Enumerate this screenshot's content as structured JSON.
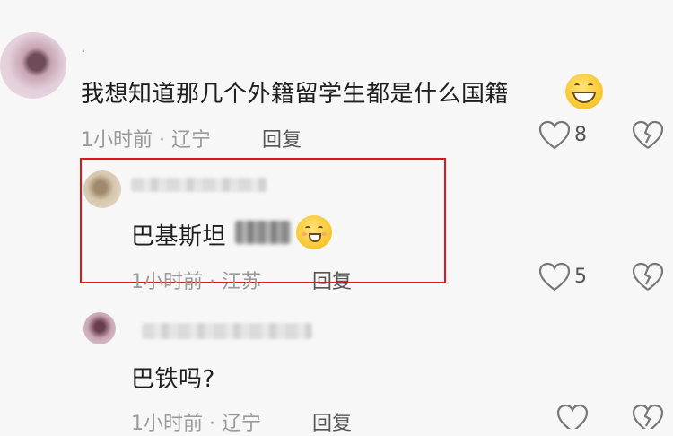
{
  "comments": [
    {
      "author": ".",
      "text": "我想知道那几个外籍留学生都是什么国籍",
      "emoji": "grinning-face-emoji",
      "time_location": "1小时前 · 辽宁",
      "reply_label": "回复",
      "likes": "8",
      "icons": [
        "heart-icon",
        "broken-heart-icon"
      ]
    },
    {
      "text": "巴基斯坦",
      "emoji": "hugging-face-emoji",
      "time_location": "1小时前 · 江苏",
      "reply_label": "回复",
      "likes": "5",
      "highlight_color": "#e01515",
      "icons": [
        "heart-icon",
        "broken-heart-icon"
      ]
    },
    {
      "text": "巴铁吗?",
      "time_location": "1小时前 · 辽宁",
      "reply_label": "回复",
      "icons": [
        "heart-icon",
        "broken-heart-icon"
      ]
    }
  ]
}
